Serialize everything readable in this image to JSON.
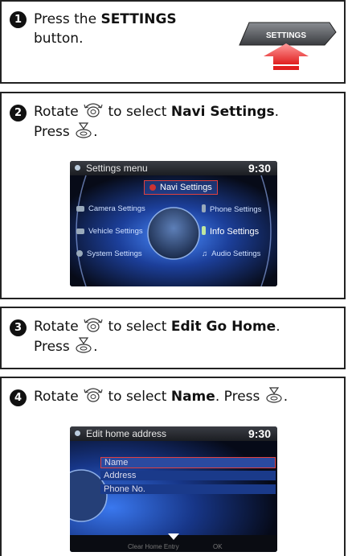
{
  "steps": [
    {
      "number": "1",
      "pre": "Press the ",
      "bold": "SETTINGS",
      "post": "button.",
      "button_label": "SETTINGS"
    },
    {
      "number": "2",
      "pre": "Rotate ",
      "mid": " to select ",
      "bold": "Navi Settings",
      "end": ".",
      "press": "Press ",
      "screen": {
        "title": "Settings menu",
        "time": "9:30",
        "items": {
          "navi": "Navi Settings",
          "camera": "Camera Settings",
          "vehicle": "Vehicle Settings",
          "system": "System Settings",
          "phone": "Phone Settings",
          "info": "Info Settings",
          "audio": "Audio Settings"
        }
      }
    },
    {
      "number": "3",
      "pre": "Rotate ",
      "mid": " to select ",
      "bold": "Edit Go Home",
      "end": ".",
      "press": "Press "
    },
    {
      "number": "4",
      "pre": "Rotate ",
      "mid": " to select ",
      "bold": "Name",
      "end": ". Press ",
      "screen": {
        "title": "Edit home address",
        "time": "9:30",
        "rows": [
          "Name",
          "Address",
          "Phone No."
        ],
        "footer_left": "Clear Home Entry",
        "footer_right": "OK"
      }
    }
  ],
  "colors": {
    "accent_red": "#e03030",
    "screen_blue": "#2f6fe0"
  }
}
